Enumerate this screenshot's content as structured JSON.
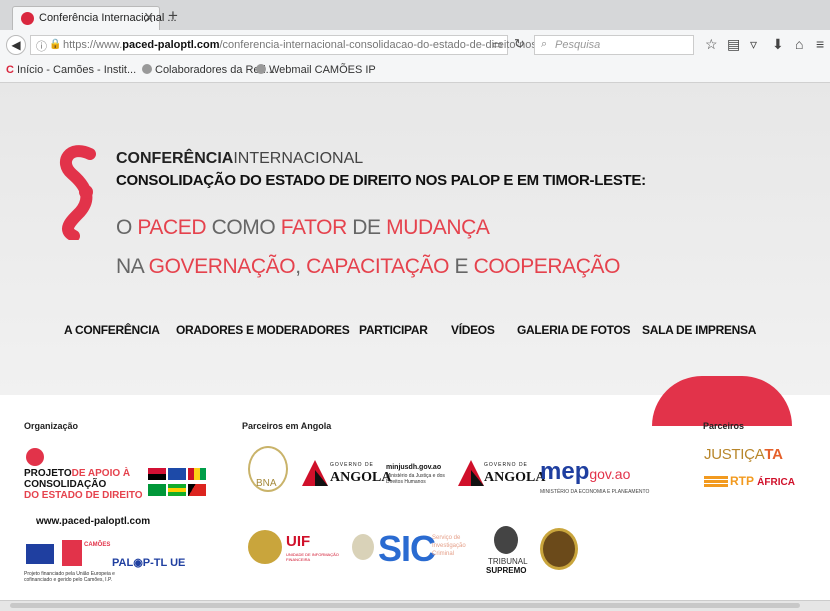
{
  "browser": {
    "tab_title": "Conferência Internacional ...",
    "tab_close": "X",
    "new_tab": "+",
    "url_prefix": "https://www.",
    "url_domain": "paced-paloptl.com",
    "url_path": "/conferencia-internacional-consolidacao-do-estado-de-direito-nos-palop",
    "search_placeholder": "Pesquisa",
    "bookmarks": [
      "Início - Camões - Instit...",
      "Colaboradores da Red...",
      "Webmail CAMÕES IP"
    ]
  },
  "hero": {
    "line1_bold": "CONFERÊNCIA",
    "line1_light": "INTERNACIONAL",
    "line2": "CONSOLIDAÇÃO DO ESTADO DE DIREITO NOS PALOP E EM TIMOR-LESTE:",
    "line3": [
      "O ",
      "PACED",
      " COMO ",
      "FATOR",
      " DE ",
      "MUDANÇA"
    ],
    "line4": [
      "NA ",
      "GOVERNAÇÃO",
      ", ",
      "CAPACITAÇÃO",
      " E ",
      "COOPERAÇÃO"
    ]
  },
  "menu": [
    "A CONFERÊNCIA",
    "ORADORES E MODERADORES",
    "PARTICIPAR",
    "VÍDEOS",
    "GALERIA DE FOTOS",
    "SALA DE IMPRENSA"
  ],
  "partners": {
    "organizacao_label": "Organização",
    "angola_label": "Parceiros em Angola",
    "parceiros_label": "Parceiros",
    "paced_logo": [
      "PROJETO",
      "DE APOIO À",
      "CONSOLIDAÇÃO",
      "DO ",
      "ESTADO",
      " DE ",
      "DIREITO"
    ],
    "paced_url": "www.paced-paloptl.com",
    "camoes_text": "CAMÕES",
    "eu_note": "Projeto financiado pela União Europeia e cofinanciado e gerido pelo Camões, I.P.",
    "palop_text": "PAL",
    "palop_text2": "P-TL UE",
    "bna": "BNA",
    "governo_de": "GOVERNO DE",
    "angola": "ANGOLA",
    "minjusdh": "minjusdh.gov.ao",
    "minjusdh_sub": "Ministério da Justiça e dos Direitos Humanos",
    "mep": "mep",
    "mep_gov": "gov.ao",
    "mep_sub": "MINISTÉRIO DA ECONOMIA E PLANEAMENTO",
    "uif": "UIF",
    "uif_sub": "UNIDADE DE INFORMAÇÃO FINANCEIRA",
    "sic": "SIC",
    "sic_sub": "Serviço de Investigação Criminal",
    "tribunal": "TRIBUNAL",
    "supremo": "SUPREMO",
    "justica": "JUSTIÇA",
    "justica_ta": "TA",
    "rtp": "RTP",
    "africa": "ÁFRICA"
  },
  "colors": {
    "accent_red": "#e2334a",
    "hero_bg": "#ececec",
    "text_dark": "#111111"
  }
}
